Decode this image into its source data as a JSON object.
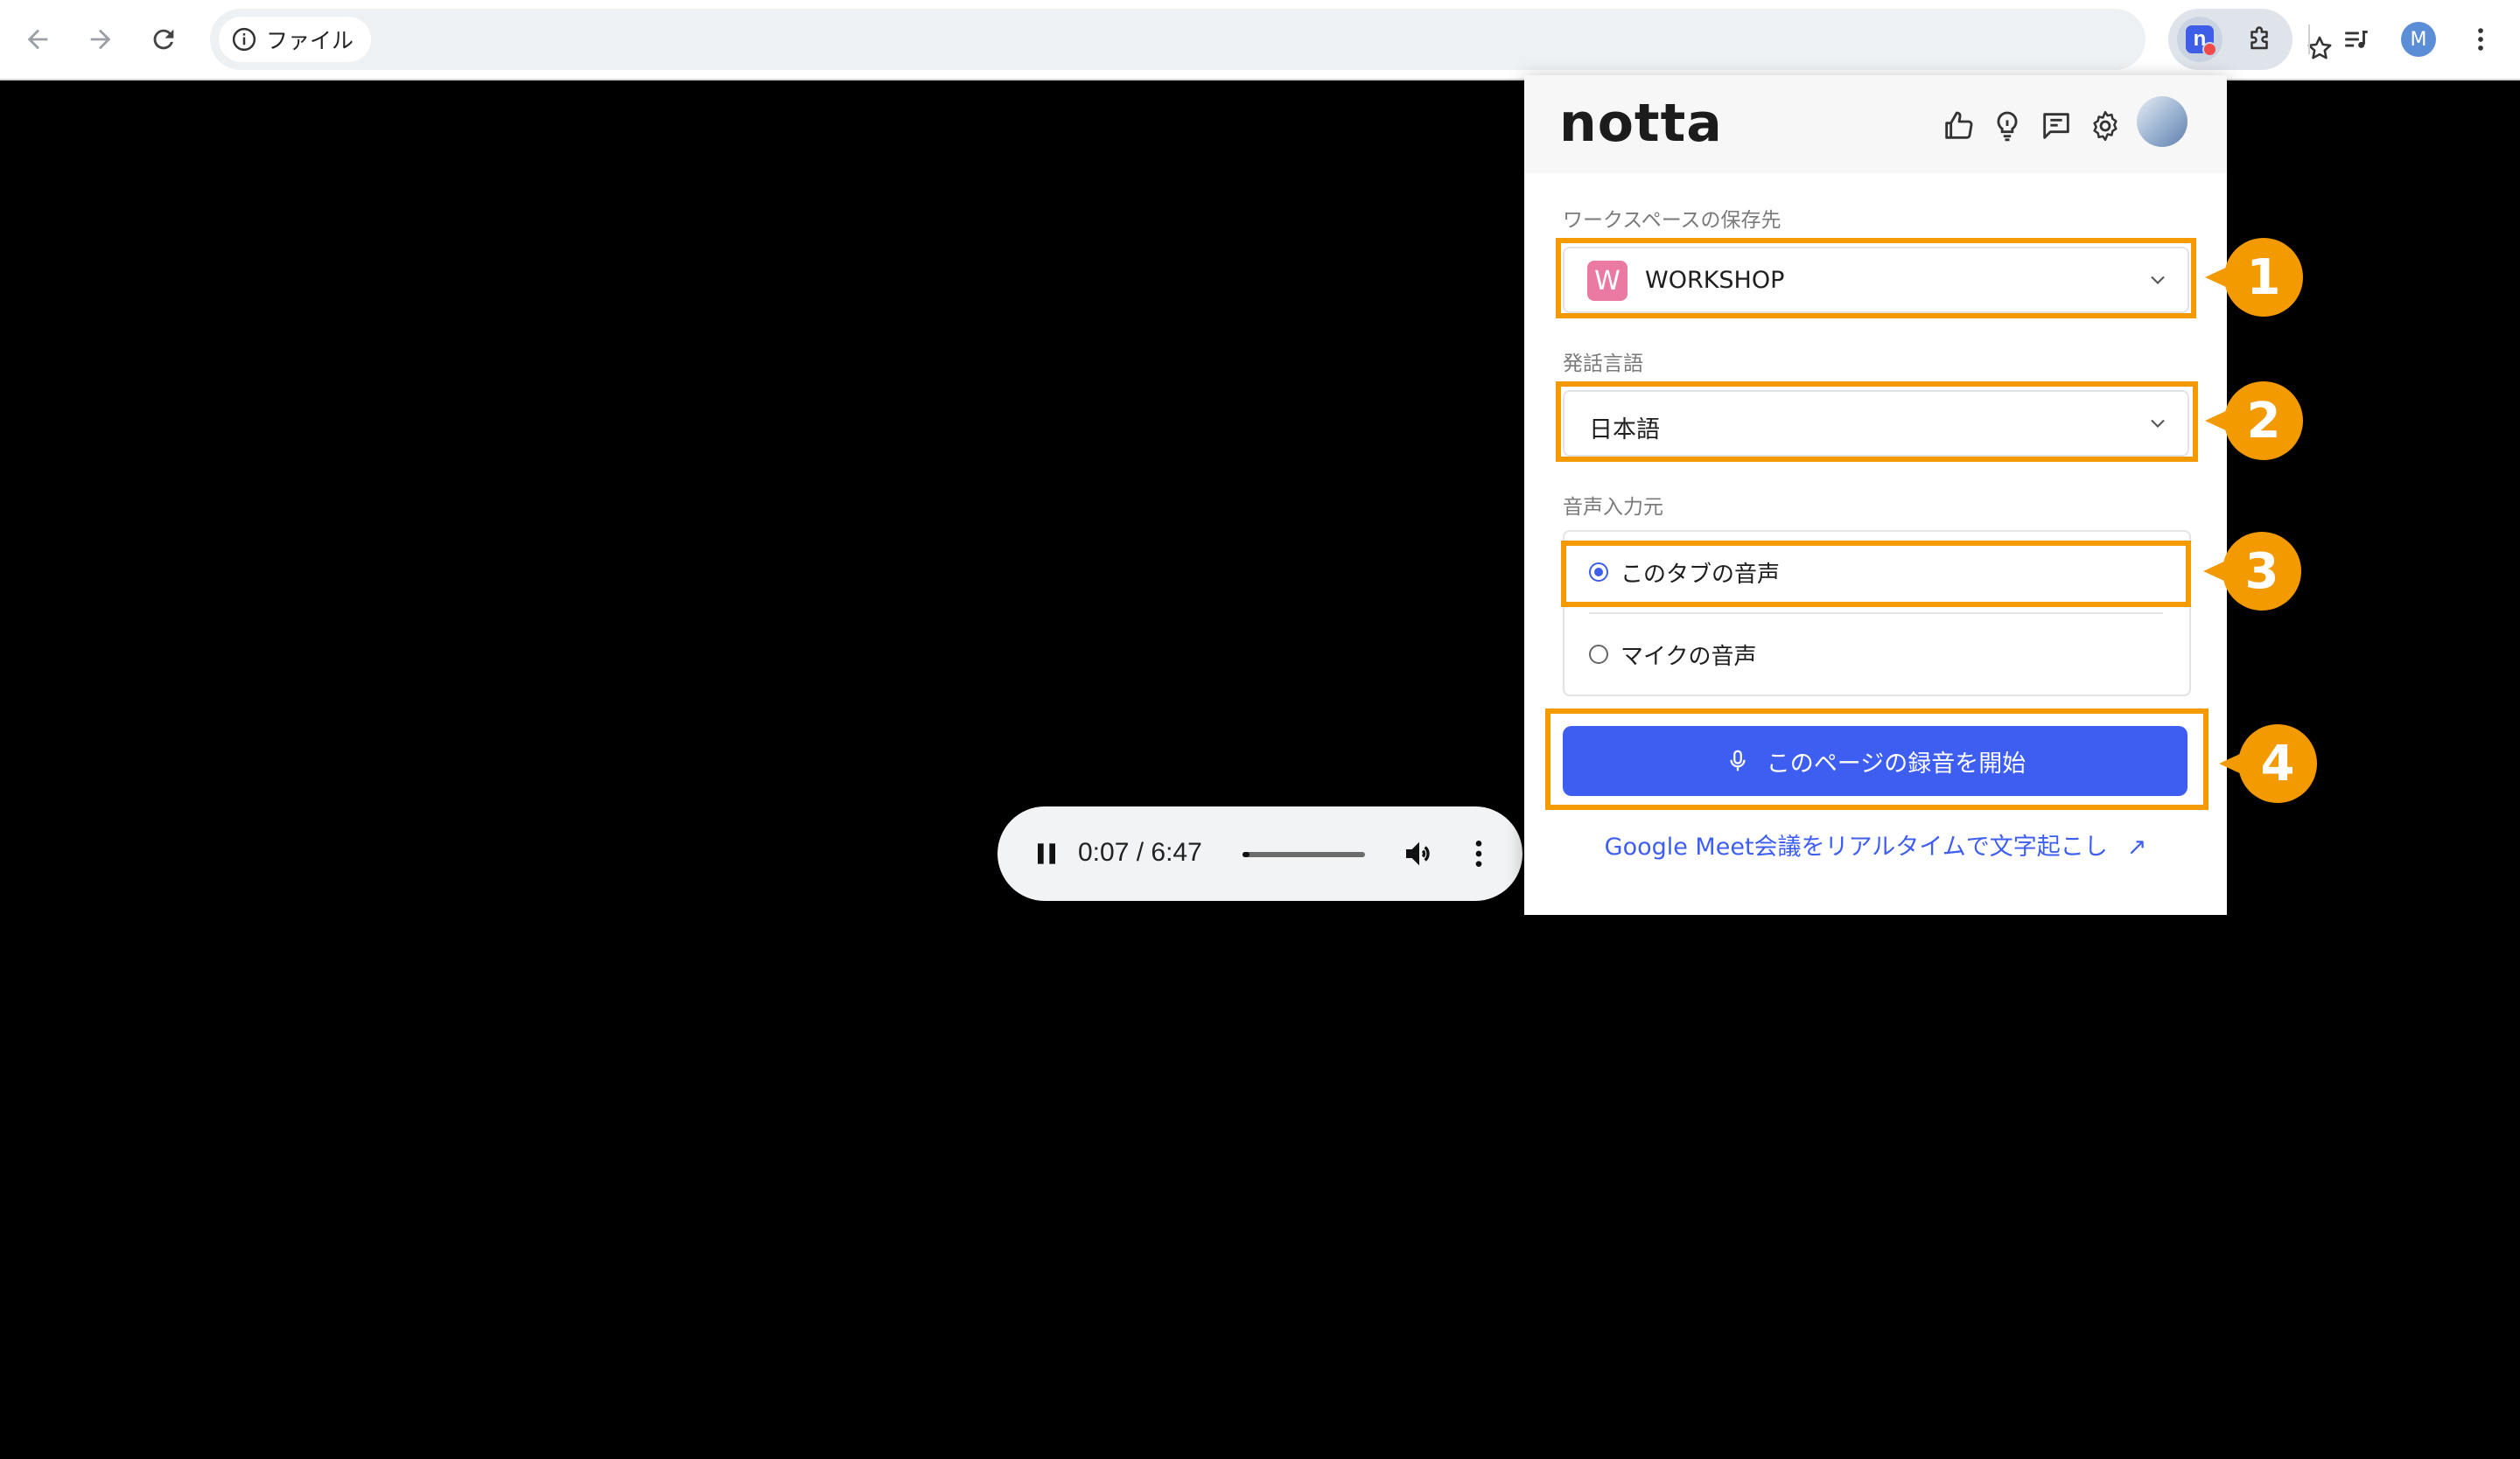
{
  "browser": {
    "site_chip_label": "ファイル",
    "profile_initial": "M"
  },
  "player": {
    "time": "0:07 / 6:47",
    "progress": 0.018
  },
  "popup": {
    "logo": "notta",
    "header_icons": [
      "thumbs-up-icon",
      "lightbulb-icon",
      "feedback-icon",
      "gear-icon"
    ],
    "workspace": {
      "label": "ワークスペースの保存先",
      "badge": "W",
      "value": "WORKSHOP"
    },
    "language": {
      "label": "発話言語",
      "value": "日本語"
    },
    "audio_source": {
      "label": "音声入力元",
      "options": [
        {
          "label": "このタブの音声",
          "selected": true
        },
        {
          "label": "マイクの音声",
          "selected": false
        }
      ]
    },
    "record_button": "このページの録音を開始",
    "meet_link": "Google Meet会議をリアルタイムで文字起こし",
    "link_arrow": "↗"
  },
  "annotations": {
    "markers": [
      "1",
      "2",
      "3",
      "4"
    ],
    "color": "#f39a00"
  },
  "colors": {
    "accent": "#3d5ef0",
    "workspace_badge": "#ea7aa1"
  }
}
